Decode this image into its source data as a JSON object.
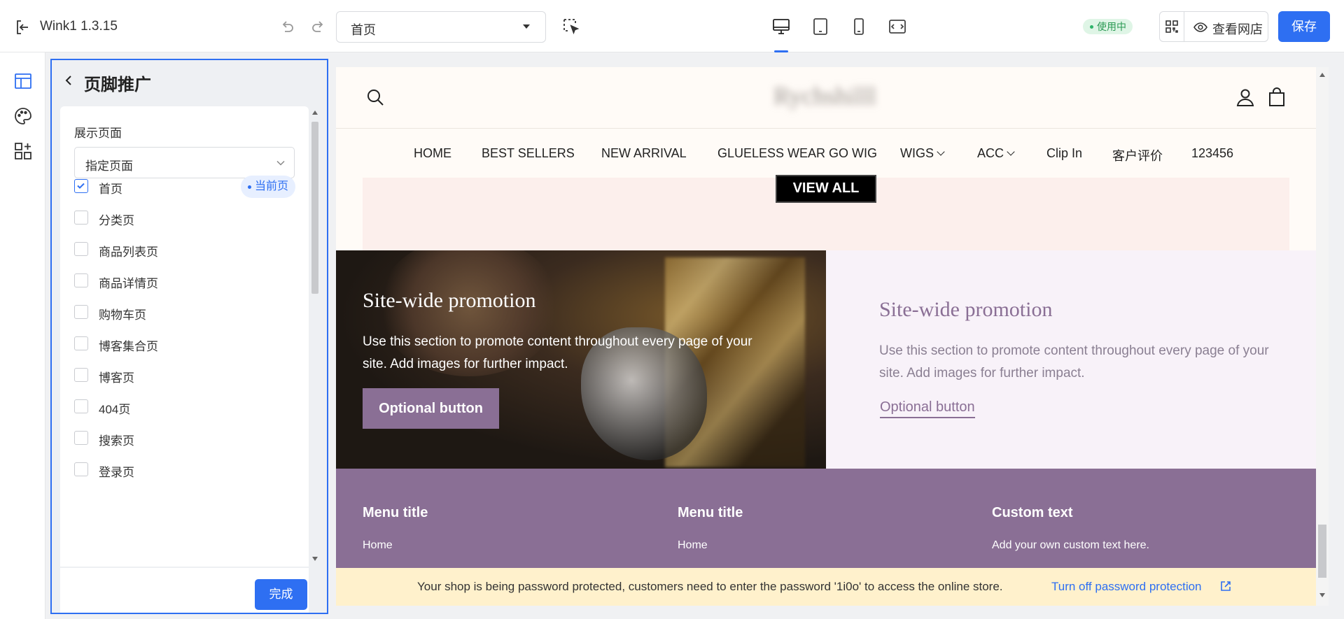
{
  "topbar": {
    "app_name": "Wink1",
    "version": "1.3.15",
    "page_select": "首页",
    "status": "使用中",
    "view_store": "查看网店",
    "save": "保存",
    "accent": "#2e6ff2"
  },
  "rail": {
    "items": [
      "layout-icon",
      "palette-icon",
      "add-widget-icon"
    ]
  },
  "panel": {
    "title": "页脚推广",
    "display_label": "展示页面",
    "display_select": "指定页面",
    "current_badge": "当前页",
    "options": [
      {
        "label": "首页",
        "checked": true
      },
      {
        "label": "分类页",
        "checked": false
      },
      {
        "label": "商品列表页",
        "checked": false
      },
      {
        "label": "商品详情页",
        "checked": false
      },
      {
        "label": "购物车页",
        "checked": false
      },
      {
        "label": "博客集合页",
        "checked": false
      },
      {
        "label": "博客页",
        "checked": false
      },
      {
        "label": "404页",
        "checked": false
      },
      {
        "label": "搜索页",
        "checked": false
      },
      {
        "label": "登录页",
        "checked": false
      }
    ],
    "done": "完成"
  },
  "preview": {
    "logo": "Rychshilll",
    "nav": [
      "HOME",
      "BEST SELLERS",
      "NEW ARRIVAL",
      "GLUELESS WEAR GO WIG",
      "WIGS",
      "ACC",
      "Clip In",
      "客户评价",
      "123456"
    ],
    "view_all": "VIEW ALL",
    "promo_left": {
      "heading": "Site-wide promotion",
      "body": "Use this section to promote content throughout every page of your site. Add images for further impact.",
      "button": "Optional button"
    },
    "promo_right": {
      "heading": "Site-wide promotion",
      "body": "Use this section to promote content throughout every page of your site. Add images for further impact.",
      "button": "Optional button"
    },
    "footer": {
      "col1": {
        "title": "Menu title",
        "link": "Home"
      },
      "col2": {
        "title": "Menu title",
        "link": "Home"
      },
      "col3": {
        "title": "Custom text",
        "link": "Add your own custom text here."
      }
    },
    "notice": {
      "message": "Your shop is being password protected, customers need to enter the password '1i0o' to access the online store.",
      "link": "Turn off password protection"
    }
  }
}
